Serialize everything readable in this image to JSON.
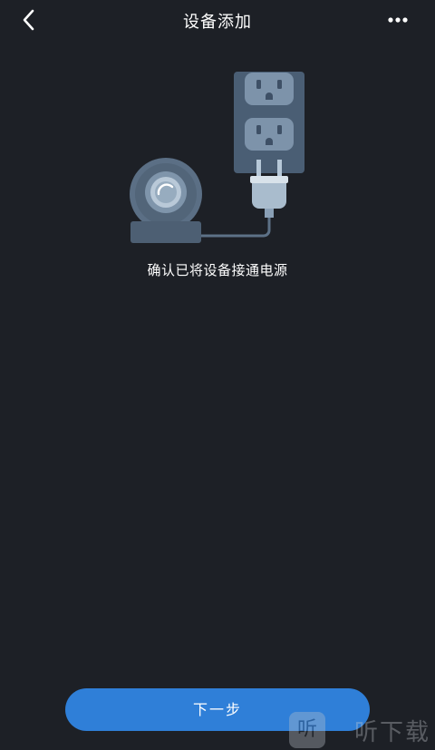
{
  "header": {
    "title": "设备添加"
  },
  "main": {
    "hint": "确认已将设备接通电源"
  },
  "footer": {
    "next_label": "下一步"
  },
  "watermark": {
    "icon_glyph": "听",
    "text": "听下载"
  },
  "colors": {
    "background": "#1d2026",
    "primary": "#2f7fd8",
    "illustration": "#5a7088"
  },
  "icons": {
    "back": "chevron-left-icon",
    "more": "more-dots-icon"
  }
}
